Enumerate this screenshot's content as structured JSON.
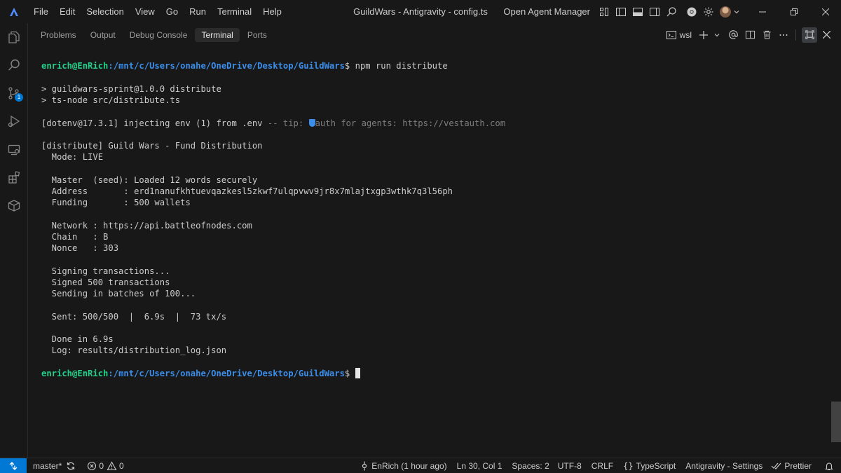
{
  "titlebar": {
    "menus": [
      "File",
      "Edit",
      "Selection",
      "View",
      "Go",
      "Run",
      "Terminal",
      "Help"
    ],
    "window_title": "GuildWars - Antigravity - config.ts",
    "agent_manager_label": "Open Agent Manager"
  },
  "activitybar": {
    "icons": [
      "explorer-icon",
      "search-icon",
      "source-control-icon",
      "run-debug-icon",
      "remote-explorer-icon",
      "extensions-icon",
      "box-icon"
    ],
    "source_control_badge": "1"
  },
  "panel": {
    "tabs": [
      "Problems",
      "Output",
      "Debug Console",
      "Terminal",
      "Ports"
    ],
    "active_tab": "Terminal",
    "terminal_profile": "wsl"
  },
  "terminal": {
    "prompt_user": "enrich@EnRich",
    "prompt_path": ":/mnt/c/Users/onahe/OneDrive/Desktop/GuildWars",
    "prompt_suffix": "$ ",
    "command": "npm run distribute",
    "script_line1": "> guildwars-sprint@1.0.0 distribute",
    "script_line2": "> ts-node src/distribute.ts",
    "dotenv_main": "[dotenv@17.3.1] injecting env (1) from .env ",
    "dotenv_tip_prefix": "-- tip: ",
    "dotenv_tip_text": "auth for agents: https://vestauth.com",
    "distribute_header": "[distribute] Guild Wars - Fund Distribution",
    "mode": "  Mode: LIVE",
    "master": "  Master  (seed): Loaded 12 words securely",
    "address": "  Address       : erd1nanufkhtuevqazkesl5zkwf7ulqpvwv9jr8x7mlajtxgp3wthk7q3l56ph",
    "funding": "  Funding       : 500 wallets",
    "network": "  Network : https://api.battleofnodes.com",
    "chain": "  Chain   : B",
    "nonce": "  Nonce   : 303",
    "signing": "  Signing transactions...",
    "signed": "  Signed 500 transactions",
    "sending": "  Sending in batches of 100...",
    "sent": "  Sent: 500/500  |  6.9s  |  73 tx/s",
    "done": "  Done in 6.9s",
    "log": "  Log: results/distribution_log.json"
  },
  "statusbar": {
    "branch": "master*",
    "errors": "0",
    "warnings": "0",
    "blame": "EnRich (1 hour ago)",
    "cursor_pos": "Ln 30, Col 1",
    "spaces": "Spaces: 2",
    "encoding": "UTF-8",
    "eol": "CRLF",
    "language": "TypeScript",
    "settings": "Antigravity - Settings",
    "formatter": "Prettier"
  },
  "colors": {
    "accent": "#0078d4",
    "prompt_user": "#23d18b",
    "prompt_path": "#3b8eea",
    "background": "#181818"
  }
}
